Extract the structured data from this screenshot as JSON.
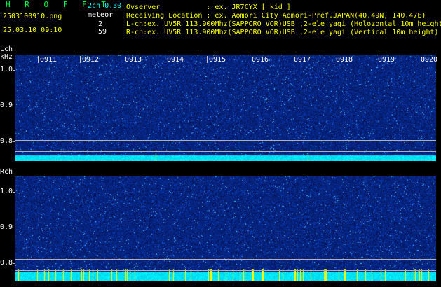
{
  "header": {
    "app_name": "H R O F F T",
    "version": "2ch 0.30",
    "filename": "2503100910.png",
    "datetime": "25.03.10 09:10",
    "meteor_label": "meteor",
    "meteor_count_l": "2",
    "meteor_count_r": "59",
    "observer": "Ovserver           : ex. JR7CYX [ kid ]",
    "location": "Receiving Location : ex. Aomori City Aomori-Pref.JAPAN(40.49N, 140.47E)",
    "lch_info": "L-ch:ex. UV5R 113.900Mhz(SAPPORO VOR)USB ,2-ele yagi (Holozontal 10m height)",
    "rch_info": "R-ch:ex. UV5R 113.900Mhz(SAPPORO VOR)USB ,2-ele yagi (Vertical 10m height)"
  },
  "lch": {
    "label": "Lch",
    "unit": "kHz",
    "yticks": [
      "1.0",
      "0.9",
      "0.8"
    ]
  },
  "rch": {
    "label": "Rch",
    "yticks": [
      "1.0",
      "0.9",
      "0.8"
    ]
  },
  "time_labels": [
    "0911",
    "0912",
    "0913",
    "0914",
    "0915",
    "0916",
    "0917",
    "0918",
    "0919",
    "0920"
  ],
  "colors": {
    "background": "#000000",
    "noise_base": "#0a1e8c",
    "signal_cyan": "#00ffff",
    "meteor_yellow": "#ffff00",
    "text_yellow": "#ffff00",
    "text_cyan": "#00ffff",
    "hroffft_green": "#00ff44"
  }
}
